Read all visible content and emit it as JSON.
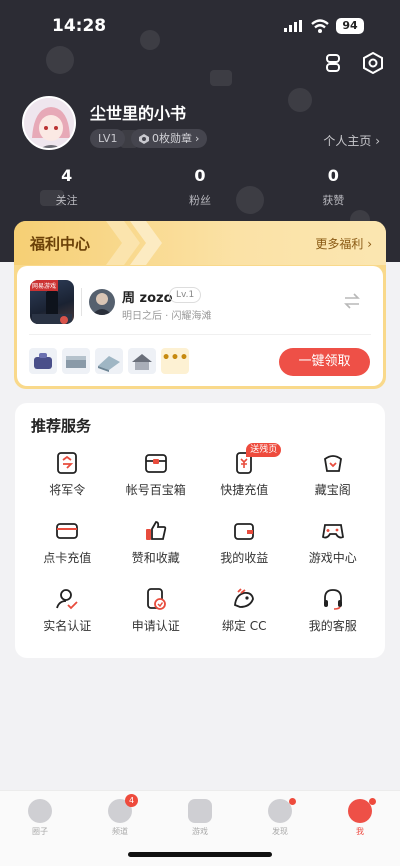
{
  "status_bar": {
    "time": "14:28",
    "battery": "94"
  },
  "profile": {
    "nickname": "尘世里的小书",
    "level": "LV1",
    "medals": "0枚勋章",
    "home_link": "个人主页"
  },
  "stats": [
    {
      "value": "4",
      "label": "关注"
    },
    {
      "value": "0",
      "label": "粉丝"
    },
    {
      "value": "0",
      "label": "获赞"
    }
  ],
  "welfare": {
    "title": "福利中心",
    "more": "更多福利",
    "cover_tag": "网易游戏",
    "role_name": "周 zozo",
    "role_level": "Lv.1",
    "role_server": "明日之后 · 闪耀海滩",
    "claim_label": "一键领取",
    "more_items": "•••"
  },
  "services": {
    "title": "推荐服务",
    "items": [
      {
        "label": "将军令",
        "icon": "token-icon"
      },
      {
        "label": "帐号百宝箱",
        "icon": "treasure-box-icon"
      },
      {
        "label": "快捷充值",
        "icon": "quick-recharge-icon",
        "badge": "送残页"
      },
      {
        "label": "藏宝阁",
        "icon": "treasure-pavilion-icon"
      },
      {
        "label": "点卡充值",
        "icon": "card-icon"
      },
      {
        "label": "赞和收藏",
        "icon": "thumbs-up-icon"
      },
      {
        "label": "我的收益",
        "icon": "wallet-icon"
      },
      {
        "label": "游戏中心",
        "icon": "gamepad-icon"
      },
      {
        "label": "实名认证",
        "icon": "user-verify-icon"
      },
      {
        "label": "申请认证",
        "icon": "apply-cert-icon"
      },
      {
        "label": "绑定 CC",
        "icon": "cc-bird-icon"
      },
      {
        "label": "我的客服",
        "icon": "headset-icon"
      }
    ]
  },
  "tabbar": [
    {
      "label": "圈子",
      "icon": "circle-icon"
    },
    {
      "label": "频道",
      "icon": "channel-icon",
      "badge": "4"
    },
    {
      "label": "游戏",
      "icon": "game-icon"
    },
    {
      "label": "发现",
      "icon": "discover-icon"
    },
    {
      "label": "我",
      "icon": "me-icon",
      "active": true
    }
  ],
  "colors": {
    "header_bg": "#2c2c34",
    "accent": "#ee5047",
    "welfare_gold": "#f9d98b"
  }
}
